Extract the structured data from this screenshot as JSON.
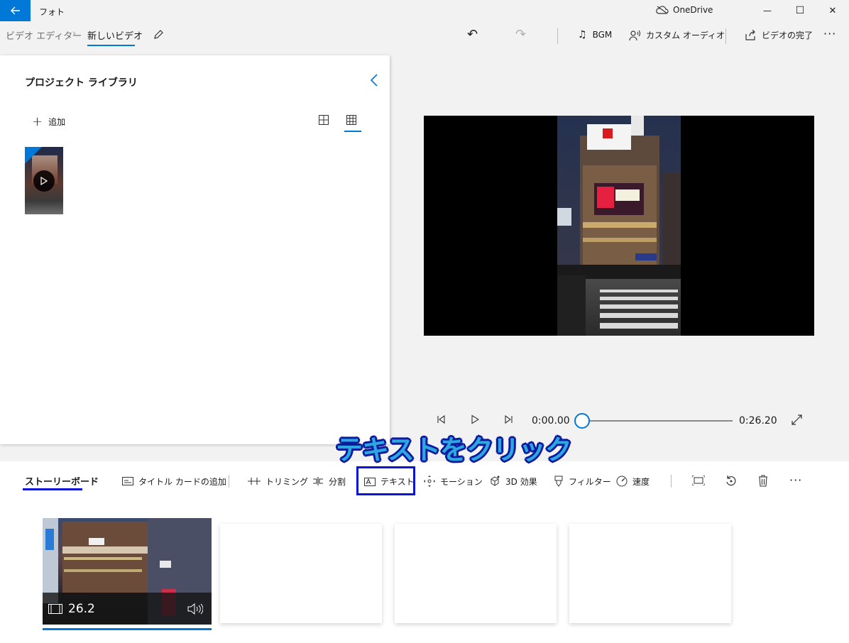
{
  "titlebar": {
    "app_title": "フォト",
    "onedrive_label": "OneDrive",
    "minimize": "—",
    "maximize": "☐",
    "close": "✕"
  },
  "commandbar": {
    "breadcrumb_parent": "ビデオ エディター",
    "breadcrumb_current": "新しいビデオ",
    "undo": "↶",
    "redo": "↷",
    "bgm_label": "BGM",
    "custom_audio_label": "カスタム オーディオ",
    "finish_video_label": "ビデオの完了",
    "more": "···"
  },
  "library": {
    "title": "プロジェクト ライブラリ",
    "add_label": "追加"
  },
  "playback": {
    "current_time": "0:00.00",
    "total_time": "0:26.20",
    "progress": 0.0
  },
  "annotation": {
    "text": "テキストをクリック"
  },
  "storyboard": {
    "title": "ストーリーボード",
    "toolbar": {
      "title_card": "タイトル カードの追加",
      "trim": "トリミング",
      "split": "分割",
      "text": "テキスト",
      "motion": "モーション",
      "effects_3d": "3D 効果",
      "filter": "フィルター",
      "speed": "速度",
      "more": "···"
    },
    "clip_duration": "26.2"
  },
  "colors": {
    "accent": "#0078d7",
    "highlight_border": "#0a14d4",
    "annotation_fill": "#2ba8e0",
    "annotation_outline": "#0d1a9e"
  }
}
